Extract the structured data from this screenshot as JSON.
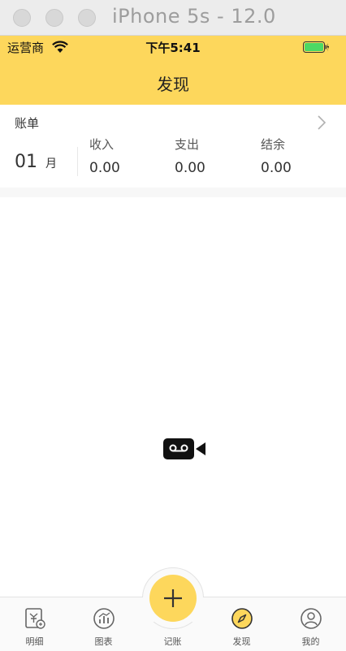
{
  "window": {
    "title": "iPhone 5s - 12.0"
  },
  "status_bar": {
    "carrier": "运营商",
    "time": "下午5:41"
  },
  "nav": {
    "title": "发现"
  },
  "bill_card": {
    "title": "账单",
    "month": "01",
    "month_unit": "月",
    "columns": [
      {
        "label": "收入",
        "value": "0.00"
      },
      {
        "label": "支出",
        "value": "0.00"
      },
      {
        "label": "结余",
        "value": "0.00"
      }
    ]
  },
  "tabs": [
    {
      "label": "明细",
      "icon": "detail-icon"
    },
    {
      "label": "图表",
      "icon": "chart-icon"
    },
    {
      "label": "记账",
      "icon": "add-icon"
    },
    {
      "label": "发现",
      "icon": "compass-icon",
      "selected": true
    },
    {
      "label": "我的",
      "icon": "profile-icon"
    }
  ],
  "colors": {
    "accent": "#fdd75c",
    "text": "#333333"
  }
}
